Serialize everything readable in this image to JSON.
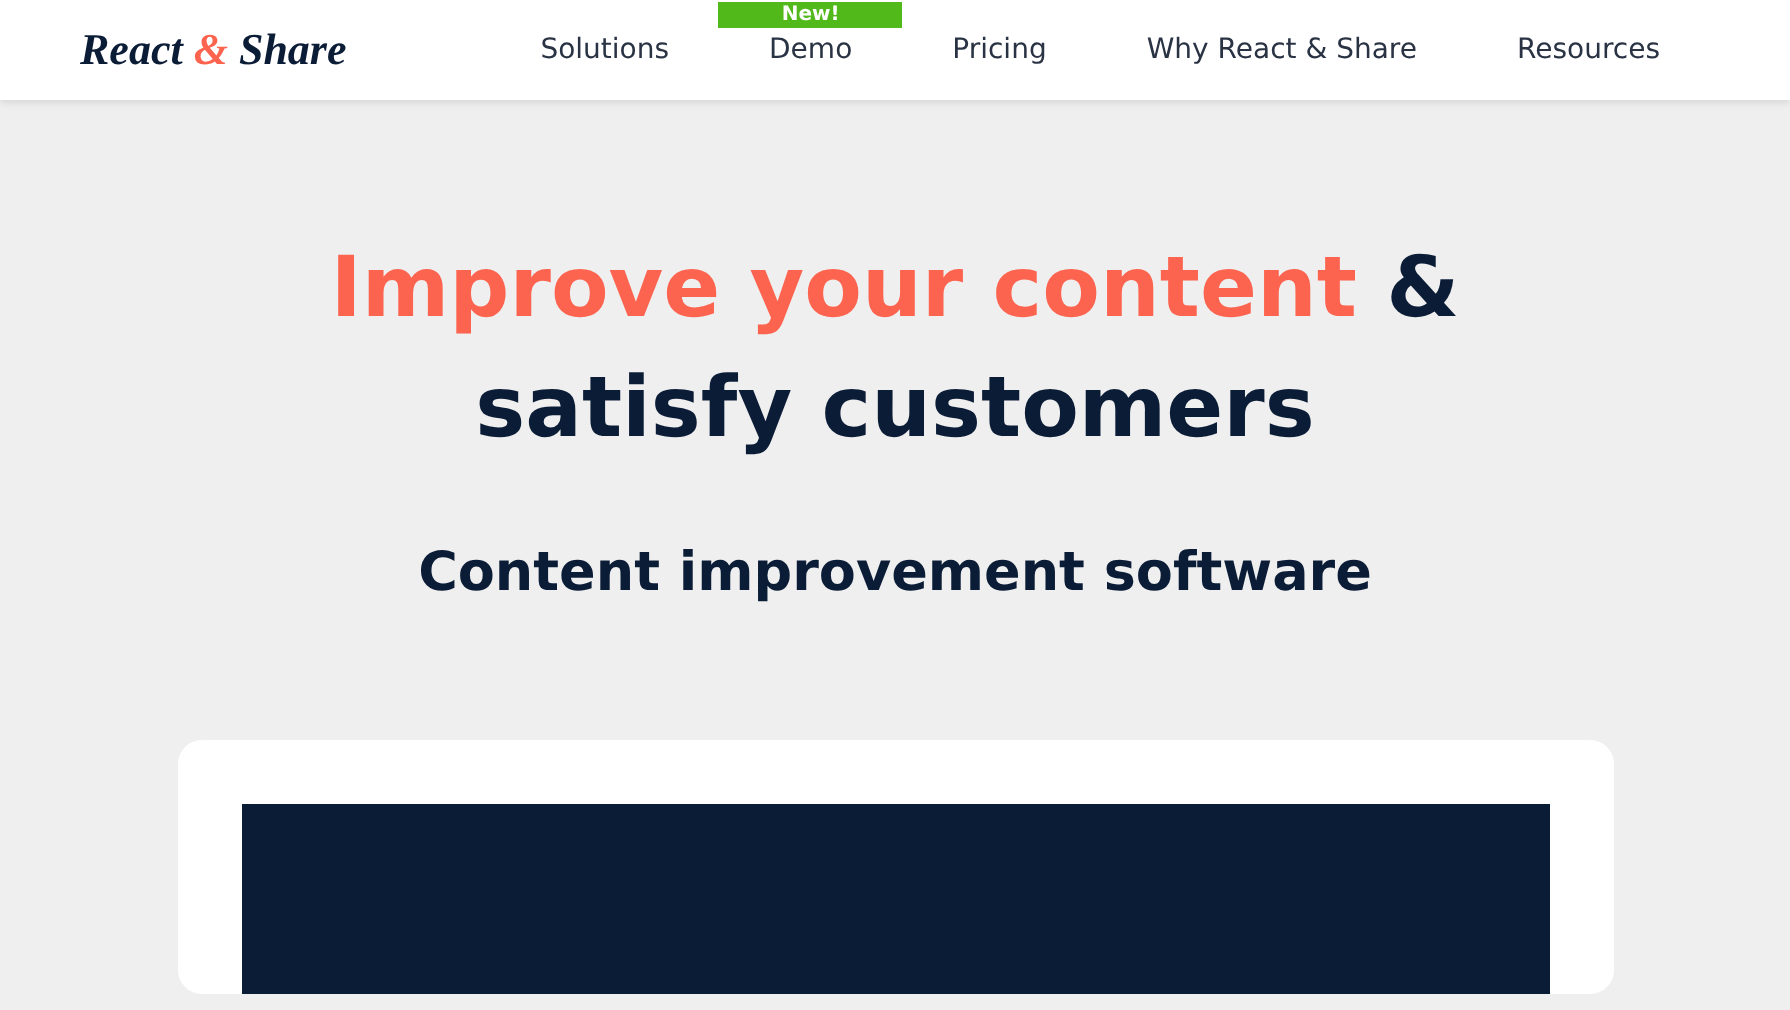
{
  "header": {
    "logo": {
      "parts": [
        {
          "text": "React ",
          "accent": false
        },
        {
          "text": "&",
          "accent": true
        },
        {
          "text": " Share",
          "accent": false
        }
      ]
    },
    "nav": [
      {
        "label": "Solutions"
      },
      {
        "label": "Demo",
        "badge": "New!"
      },
      {
        "label": "Pricing"
      },
      {
        "label": "Why React & Share"
      },
      {
        "label": "Resources"
      }
    ]
  },
  "hero": {
    "headline": [
      {
        "text": "Improve your content",
        "accent": true
      },
      {
        "text": " & ",
        "accent": false
      },
      {
        "text": "satisfy customers",
        "accent": false
      }
    ],
    "subtitle": "Content improvement software"
  }
}
